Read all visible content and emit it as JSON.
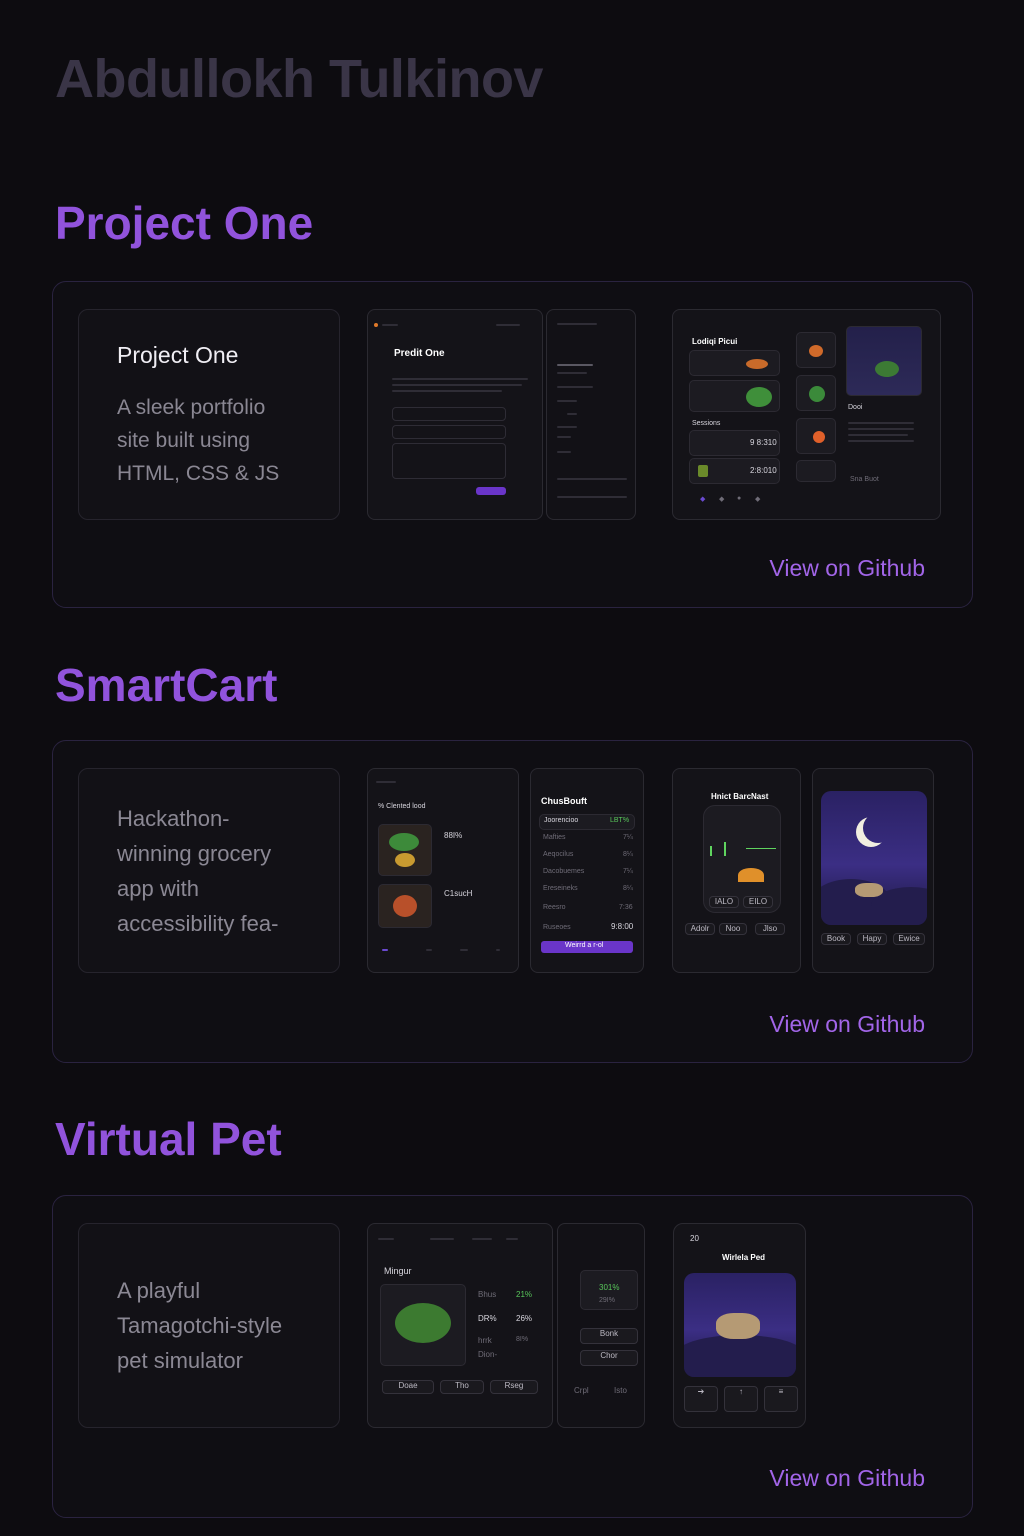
{
  "owner_name": "Abdullokh Tulkinov",
  "projects": [
    {
      "title": "Project One",
      "card_heading": "Project One",
      "description": "A sleek portfolio site built using HTML, CSS & JS",
      "link_label": "View on Github",
      "screens": {
        "contact_title": "Predit One",
        "right_heading": "Lodiqi Picui",
        "row_values": [
          "9 8:310",
          "2:8:010"
        ],
        "side_label": "Dooi",
        "side_btn": "Sna Buot"
      }
    },
    {
      "title": "SmartCart",
      "description": "Hackathon-winning grocery app with accessibility fea-",
      "link_label": "View on Github",
      "screens": {
        "list_title": "% Clented lood",
        "tile_1_value": "88I%",
        "tile_2_value": "C1sucH",
        "checkout_title": "ChusBouft",
        "checkout_first_row": "Joorencioo",
        "checkout_first_value": "LBT%",
        "checkout_rows": [
          "Mafties",
          "Aeqocilus",
          "Dacobuemes",
          "Ereseineks"
        ],
        "checkout_row_values": [
          "7¼",
          "8¼",
          "7¼",
          "8¼"
        ],
        "checkout_extra": [
          [
            "Reesro",
            "7:36"
          ],
          [
            "Ruseoes",
            "9:8:00"
          ]
        ],
        "checkout_button": "Weirrd a r-ol",
        "barcode_title": "Hnict BarcNast",
        "barcode_chips": [
          "IALO",
          "EILO"
        ],
        "barcode_buttons": [
          "Adolr",
          "Noo",
          "Jlso"
        ],
        "pet_buttons": [
          "Book",
          "Hapy",
          "Ewice"
        ]
      }
    },
    {
      "title": "Virtual Pet",
      "description": "A playful Tamagotchi-style pet simulator",
      "link_label": "View on Github",
      "screens": {
        "pet_name": "Mingur",
        "stats": [
          [
            "Bhus",
            "21%"
          ],
          [
            "DR%",
            "26%"
          ],
          [
            "hrrk",
            "8I%"
          ],
          [
            "Dion-",
            ""
          ]
        ],
        "actions": [
          "Doae",
          "Tho",
          "Rseg"
        ],
        "side_stats": [
          "301%",
          "29I%"
        ],
        "side_buttons": [
          "Bonk",
          "Chor"
        ],
        "side_footer": [
          "Crpl",
          "Isto"
        ],
        "phone_time": "20",
        "phone_title": "Wirlela Ped"
      }
    }
  ],
  "colors": {
    "background": "#0d0c10",
    "accent": "#9153dc",
    "link": "#a265e8",
    "owner": "#3a3547",
    "card_border": "#2a2340"
  }
}
